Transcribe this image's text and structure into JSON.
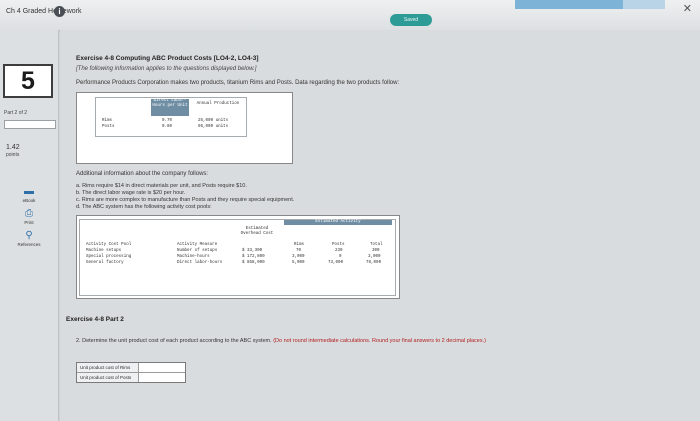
{
  "header": {
    "title": "Ch 4 Graded Homework",
    "info_glyph": "i",
    "saved_label": "Saved",
    "progress_fraction": 0.72,
    "close_glyph": "✕"
  },
  "sidebar": {
    "question_number": "5",
    "part": "Part 2 of 2",
    "points_value": "1.42",
    "points_label": "points",
    "buttons": [
      {
        "label": "eBook",
        "icon": "ebook-icon",
        "glyph": "▬"
      },
      {
        "label": "Print",
        "icon": "print-icon",
        "glyph": "⎙"
      },
      {
        "label": "References",
        "icon": "references-icon",
        "glyph": "⚲"
      }
    ]
  },
  "exercise": {
    "title": "Exercise 4-8 Computing ABC Product Costs [LO4-2, LO4-3]",
    "note": "[The following information applies to the questions displayed below.]",
    "intro": "Performance Products Corporation makes two products, titanium Rims and Posts. Data regarding the two products follow:",
    "table1": {
      "col_labor": "Direct Labor-Hours per Unit",
      "col_production": "Annual Production",
      "rows": [
        {
          "product": "Rims",
          "labor": "0.70",
          "production": "26,000 units"
        },
        {
          "product": "Posts",
          "labor": "0.80",
          "production": "96,000 units"
        }
      ]
    },
    "additional_title": "Additional information about the company follows:",
    "additional_items": [
      "a. Rims require $14 in direct materials per unit, and Posts require $10.",
      "b. The direct labor wage rate is $20 per hour.",
      "c. Rims are more complex to manufacture than Posts and they require special equipment.",
      "d. The ABC system has the following activity cost pools:"
    ],
    "table2": {
      "est_activity": "Estimated Activity",
      "col_pool": "Activity Cost Pool",
      "col_measure": "Activity Measure",
      "col_overhead": "Estimated Overhead Cost",
      "col_rims": "Rims",
      "col_posts": "Posts",
      "col_total": "Total",
      "rows": [
        {
          "pool": "Machine setups",
          "measure": "Number of setups",
          "overhead": "$ 33,300",
          "rims": "70",
          "posts": "230",
          "total": "300"
        },
        {
          "pool": "Special processing",
          "measure": "Machine-hours",
          "overhead": "$ 172,800",
          "rims": "3,000",
          "posts": "0",
          "total": "3,000"
        },
        {
          "pool": "General factory",
          "measure": "Direct labor-hours",
          "overhead": "$ 858,000",
          "rims": "5,000",
          "posts": "73,000",
          "total": "78,000"
        }
      ]
    }
  },
  "part2": {
    "title": "Exercise 4-8 Part 2",
    "instruction": "2. Determine the unit product cost of each product according to the ABC system.",
    "instruction_red": "(Do not round intermediate calculations. Round your final answers to 2 decimal places.)",
    "answers": [
      {
        "label": "Unit product cost of Rims",
        "value": ""
      },
      {
        "label": "Unit product cost of Posts",
        "value": ""
      }
    ]
  }
}
